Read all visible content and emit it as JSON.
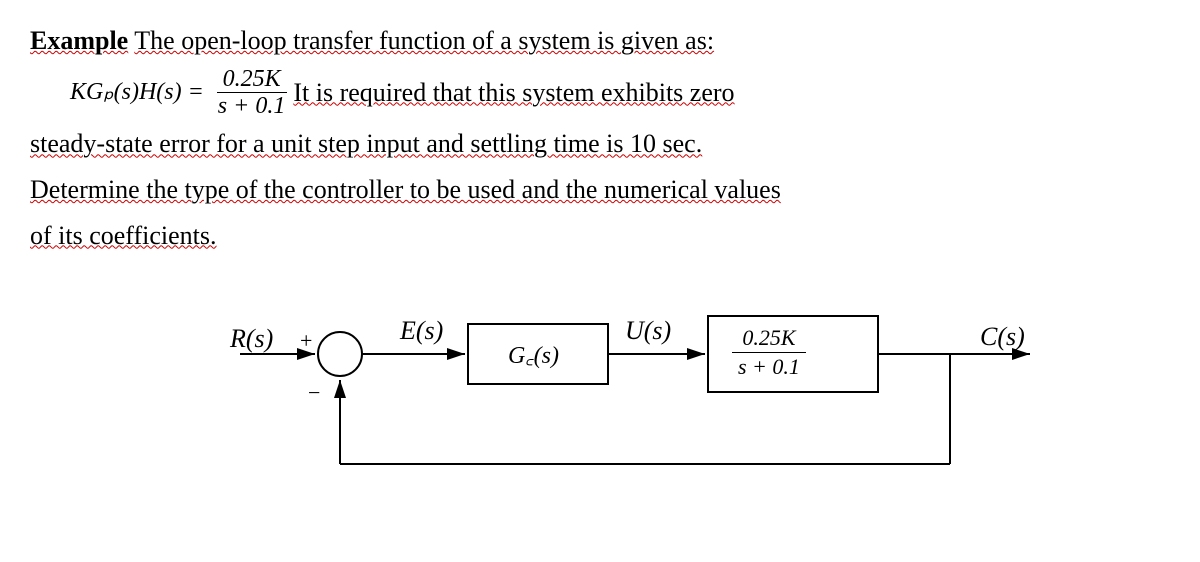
{
  "problem": {
    "header": "Example",
    "intro_rest": " The open-loop transfer function of a system is given as:",
    "equation_lhs": "KGₚ(s)H(s) = ",
    "equation_num": "0.25K",
    "equation_den": "s + 0.1",
    "req_part1": "It is required that this system exhibits zero",
    "line3": "steady-state error   for a unit step input and settling time is 10 sec.",
    "line4": "Determine the type of the controller to be used and the numerical values",
    "line5": "of its coefficients."
  },
  "diagram": {
    "R": "R(s)",
    "plus": "+",
    "minus": "−",
    "E": "E(s)",
    "Gc": "G꜀(s)",
    "U": "U(s)",
    "plant_num": "0.25K",
    "plant_den": "s + 0.1",
    "C": "C(s)"
  }
}
